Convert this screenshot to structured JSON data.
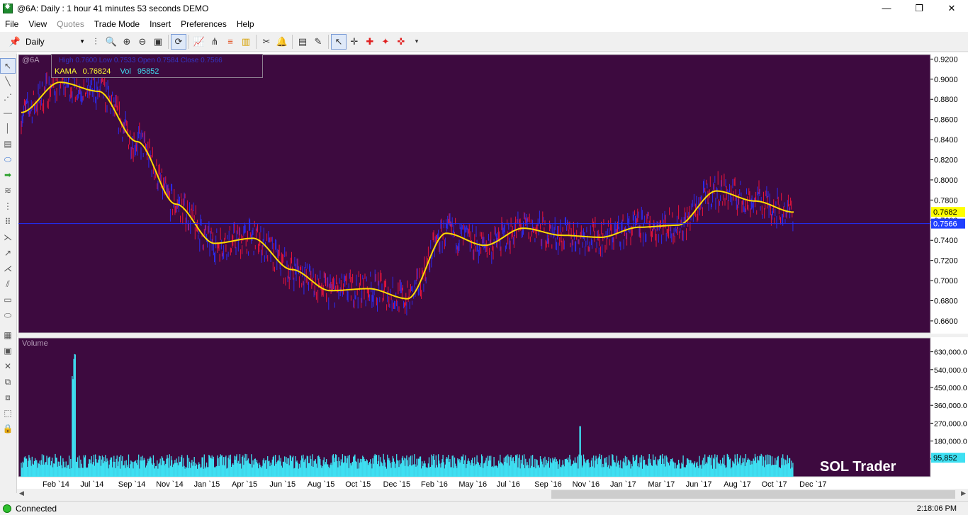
{
  "window": {
    "title": "@6A: Daily : 1 hour 41 minutes 53 seconds DEMO",
    "minimize": "—",
    "maximize": "❐",
    "close": "✕"
  },
  "menu": [
    "File",
    "View",
    "Quotes",
    "Trade Mode",
    "Insert",
    "Preferences",
    "Help"
  ],
  "menu_disabled": [
    "Quotes"
  ],
  "toolbar": {
    "period": "Daily",
    "icons": [
      "pin-icon",
      "bar-type-icon",
      "zoom-icon",
      "zoom-in-icon",
      "zoom-out-icon",
      "fit-icon",
      "auto-scroll-icon",
      "indicator-icon",
      "tree-icon",
      "color-bars-icon",
      "histogram-icon",
      "tools-icon",
      "alert-bell-icon",
      "template-icon",
      "draw-icon",
      "cursor-icon",
      "crosshair-icon",
      "cross-red-icon",
      "star-cross-icon",
      "cross-dot-icon"
    ]
  },
  "legend": {
    "line1": "High 0.7600  Low 0.7533  Open 0.7584  Close 0.7566",
    "kama_label": "KAMA",
    "kama_value": "0.76824",
    "vol_label": "Vol",
    "vol_value": "95852"
  },
  "symbol_label": "@6A",
  "volume_title": "Volume",
  "watermark": "SOL Trader",
  "status": {
    "connection": "Connected",
    "time": "2:18:06 PM"
  },
  "colors": {
    "chart_bg": "#3d0a3f",
    "up_bar": "#2c2cf0",
    "down_bar": "#e8143c",
    "kama": "#ffdd00",
    "volume": "#3ee0f2",
    "hline": "#2030ff",
    "kama_badge": "#ffff00",
    "price_badge": "#2040ff",
    "vol_badge": "#3ee0f2"
  },
  "chart_data": {
    "type": "line",
    "series": [
      {
        "name": "KAMA",
        "x": [
          "Feb '14",
          "Jul '14",
          "Sep '14",
          "Nov '14",
          "Jan '15",
          "Apr '15",
          "Jun '15",
          "Aug '15",
          "Oct '15",
          "Dec '15",
          "Feb '16",
          "May '16",
          "Jul '16",
          "Sep '16",
          "Nov '16",
          "Jan '17",
          "Mar '17",
          "Jun '17",
          "Aug '17",
          "Oct '17",
          "Nov '17"
        ],
        "values": [
          0.867,
          0.897,
          0.888,
          0.838,
          0.776,
          0.737,
          0.742,
          0.711,
          0.69,
          0.692,
          0.682,
          0.747,
          0.735,
          0.752,
          0.745,
          0.743,
          0.753,
          0.755,
          0.789,
          0.779,
          0.768
        ]
      }
    ],
    "price_axis": [
      "0.9200",
      "0.9000",
      "0.8800",
      "0.8600",
      "0.8400",
      "0.8200",
      "0.8000",
      "0.7800",
      "0.7600",
      "0.7400",
      "0.7200",
      "0.7000",
      "0.6800",
      "0.6600"
    ],
    "ylim": [
      0.648,
      0.9245
    ],
    "volume_axis": [
      "630,000.0",
      "540,000.0",
      "450,000.0",
      "360,000.0",
      "270,000.0",
      "180,000.0",
      "90,000.0"
    ],
    "volume_ylim": [
      0,
      700000
    ],
    "x_axis": [
      "Feb `14",
      "Jul `14",
      "Sep `14",
      "Nov `14",
      "Jan `15",
      "Apr `15",
      "Jun `15",
      "Aug `15",
      "Oct `15",
      "Dec `15",
      "Feb `16",
      "May `16",
      "Jul `16",
      "Sep `16",
      "Nov `16",
      "Jan `17",
      "Mar `17",
      "Jun `17",
      "Aug `17",
      "Oct `17",
      "Dec `17"
    ],
    "last_close": 0.7566,
    "kama_last": "0.7682",
    "close_label": "0.7566",
    "vol_last": "95,852",
    "vol_last_value": 95852,
    "volume_spikes": [
      {
        "date": "Jun '14",
        "value": 640000
      },
      {
        "date": "Nov '16",
        "value": 255000
      }
    ],
    "grid": false
  }
}
